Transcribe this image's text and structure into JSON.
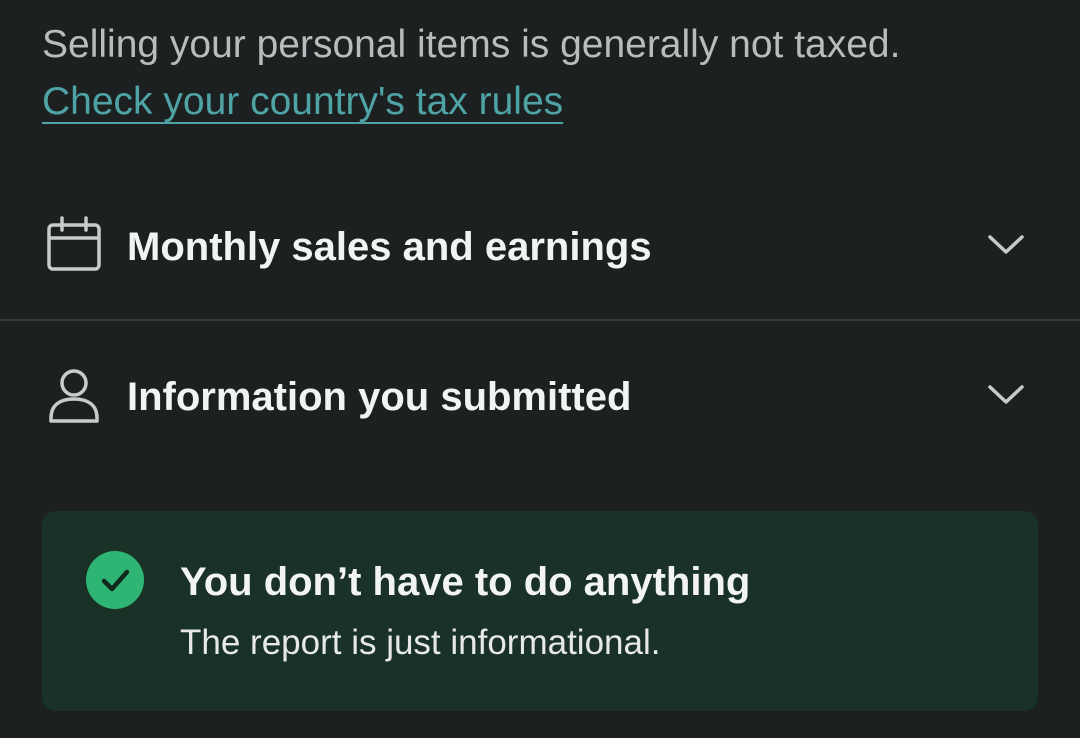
{
  "intro": {
    "text": "Selling your personal items is generally not taxed.",
    "link_label": "Check your country's tax rules"
  },
  "sections": [
    {
      "title": "Monthly sales and earnings",
      "icon": "calendar-icon"
    },
    {
      "title": "Information you submitted",
      "icon": "user-icon"
    }
  ],
  "notice": {
    "title": "You don’t have to do anything",
    "subtitle": "The report is just informational.",
    "icon": "check-circle-icon"
  },
  "colors": {
    "background": "#1c2021",
    "link": "#4fa3a5",
    "notice_background": "#193126",
    "success": "#2fb573"
  }
}
